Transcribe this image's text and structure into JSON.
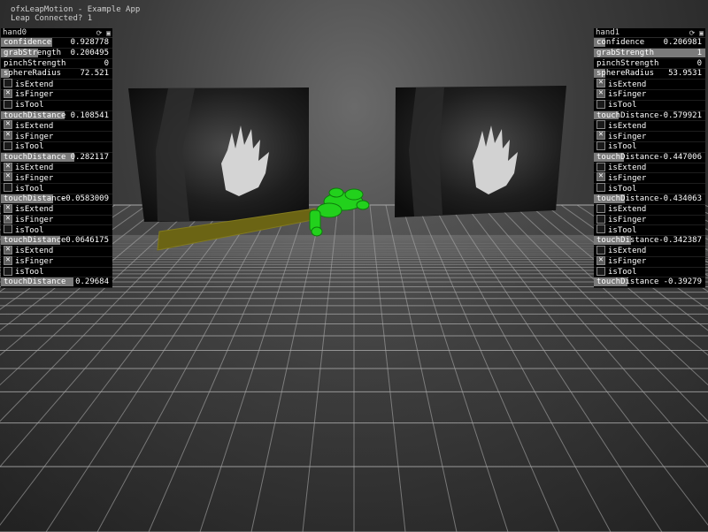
{
  "app": {
    "title": "ofxLeapMotion - Example App",
    "status": "Leap Connected? 1"
  },
  "hand0": {
    "title": "hand0",
    "rows": [
      {
        "type": "slider",
        "label": "confidence",
        "value": "0.928778",
        "fill": 0.46
      },
      {
        "type": "slider",
        "label": "grabStrength",
        "value": "0.200495",
        "fill": 0.33
      },
      {
        "type": "slider",
        "label": "pinchStrength",
        "value": "0",
        "fill": 0
      },
      {
        "type": "slider",
        "label": "sphereRadius",
        "value": "72.521",
        "fill": 0.07
      },
      {
        "type": "toggle",
        "label": "isExtend",
        "checked": false
      },
      {
        "type": "toggle",
        "label": "isFinger",
        "checked": true
      },
      {
        "type": "toggle",
        "label": "isTool",
        "checked": false
      },
      {
        "type": "slider",
        "label": "touchDistance",
        "value": "0.108541",
        "fill": 0.57
      },
      {
        "type": "toggle",
        "label": "isExtend",
        "checked": true
      },
      {
        "type": "toggle",
        "label": "isFinger",
        "checked": true
      },
      {
        "type": "toggle",
        "label": "isTool",
        "checked": false
      },
      {
        "type": "slider",
        "label": "touchDistance",
        "value": "0.282117",
        "fill": 0.66
      },
      {
        "type": "toggle",
        "label": "isExtend",
        "checked": true
      },
      {
        "type": "toggle",
        "label": "isFinger",
        "checked": true
      },
      {
        "type": "toggle",
        "label": "isTool",
        "checked": false
      },
      {
        "type": "slider",
        "label": "touchDistance",
        "value": "-0.0583009",
        "fill": 0.47
      },
      {
        "type": "toggle",
        "label": "isExtend",
        "checked": true
      },
      {
        "type": "toggle",
        "label": "isFinger",
        "checked": true
      },
      {
        "type": "toggle",
        "label": "isTool",
        "checked": false
      },
      {
        "type": "slider",
        "label": "touchDistance",
        "value": "0.0646175",
        "fill": 0.53
      },
      {
        "type": "toggle",
        "label": "isExtend",
        "checked": true
      },
      {
        "type": "toggle",
        "label": "isFinger",
        "checked": true
      },
      {
        "type": "toggle",
        "label": "isTool",
        "checked": false
      },
      {
        "type": "slider",
        "label": "touchDistance",
        "value": "0.29684",
        "fill": 0.65
      }
    ]
  },
  "hand1": {
    "title": "hand1",
    "rows": [
      {
        "type": "slider",
        "label": "confidence",
        "value": "0.206981",
        "fill": 0.1
      },
      {
        "type": "slider",
        "label": "grabStrength",
        "value": "1",
        "fill": 1
      },
      {
        "type": "slider",
        "label": "pinchStrength",
        "value": "0",
        "fill": 0
      },
      {
        "type": "slider",
        "label": "sphereRadius",
        "value": "53.9531",
        "fill": 0.1
      },
      {
        "type": "toggle",
        "label": "isExtend",
        "checked": true
      },
      {
        "type": "toggle",
        "label": "isFinger",
        "checked": true
      },
      {
        "type": "toggle",
        "label": "isTool",
        "checked": false
      },
      {
        "type": "slider",
        "label": "touchDistance",
        "value": "-0.579921",
        "fill": 0.22
      },
      {
        "type": "toggle",
        "label": "isExtend",
        "checked": false
      },
      {
        "type": "toggle",
        "label": "isFinger",
        "checked": true
      },
      {
        "type": "toggle",
        "label": "isTool",
        "checked": false
      },
      {
        "type": "slider",
        "label": "touchDistance",
        "value": "-0.447006",
        "fill": 0.27
      },
      {
        "type": "toggle",
        "label": "isExtend",
        "checked": false
      },
      {
        "type": "toggle",
        "label": "isFinger",
        "checked": true
      },
      {
        "type": "toggle",
        "label": "isTool",
        "checked": false
      },
      {
        "type": "slider",
        "label": "touchDistance",
        "value": "-0.434063",
        "fill": 0.28
      },
      {
        "type": "toggle",
        "label": "isExtend",
        "checked": false
      },
      {
        "type": "toggle",
        "label": "isFinger",
        "checked": false
      },
      {
        "type": "toggle",
        "label": "isTool",
        "checked": false
      },
      {
        "type": "slider",
        "label": "touchDistance",
        "value": "-0.342387",
        "fill": 0.33
      },
      {
        "type": "toggle",
        "label": "isExtend",
        "checked": false
      },
      {
        "type": "toggle",
        "label": "isFinger",
        "checked": true
      },
      {
        "type": "toggle",
        "label": "isTool",
        "checked": false
      },
      {
        "type": "slider",
        "label": "touchDistance",
        "value": "-0.39279",
        "fill": 0.3
      }
    ]
  },
  "icons": {
    "refresh": "refresh-icon",
    "save": "save-icon"
  }
}
